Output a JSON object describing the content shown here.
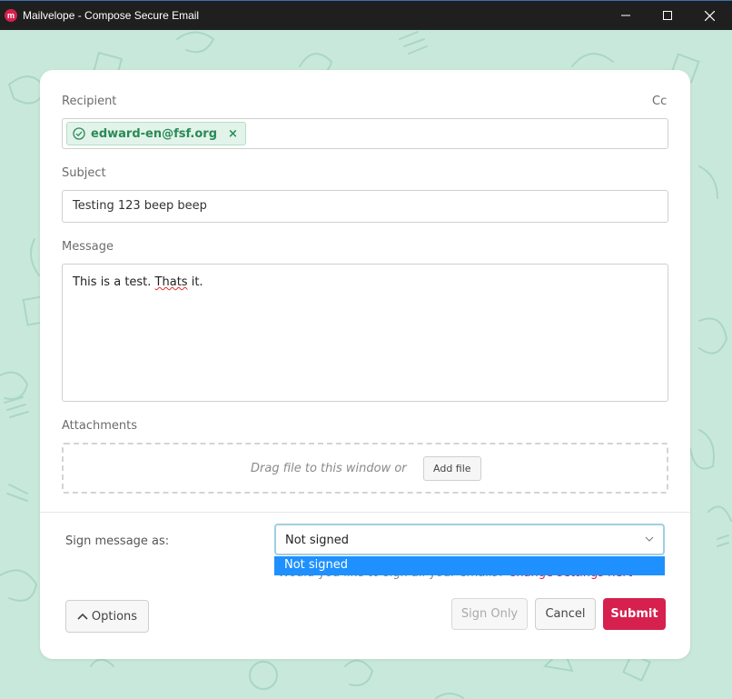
{
  "window": {
    "title": "Mailvelope - Compose Secure Email",
    "app_icon": "mailvelope-logo-icon"
  },
  "colors": {
    "brand": "#d6204e",
    "background": "#c9e8dc",
    "recipient_tag": "#2a8a55",
    "select_highlight": "#1e90ff"
  },
  "compose": {
    "recipient_label": "Recipient",
    "cc_label": "Cc",
    "recipients": [
      {
        "email": "edward-en@fsf.org",
        "status": "verified"
      }
    ],
    "recipient_remove": "×",
    "subject_label": "Subject",
    "subject_value": "Testing 123 beep beep",
    "message_label": "Message",
    "message_before": "This is a test. ",
    "message_misspelled": "Thats",
    "message_after": " it.",
    "attachments_label": "Attachments",
    "drop_text": "Drag file to this window or",
    "add_file_label": "Add file"
  },
  "signing": {
    "label": "Sign message as:",
    "selected": "Not signed",
    "options": [
      "Not signed"
    ],
    "hint": "Would you like to sign all your emails? ",
    "hint_link": "Change settings here"
  },
  "footer": {
    "options_label": "Options",
    "sign_only_label": "Sign Only",
    "cancel_label": "Cancel",
    "submit_label": "Submit"
  }
}
